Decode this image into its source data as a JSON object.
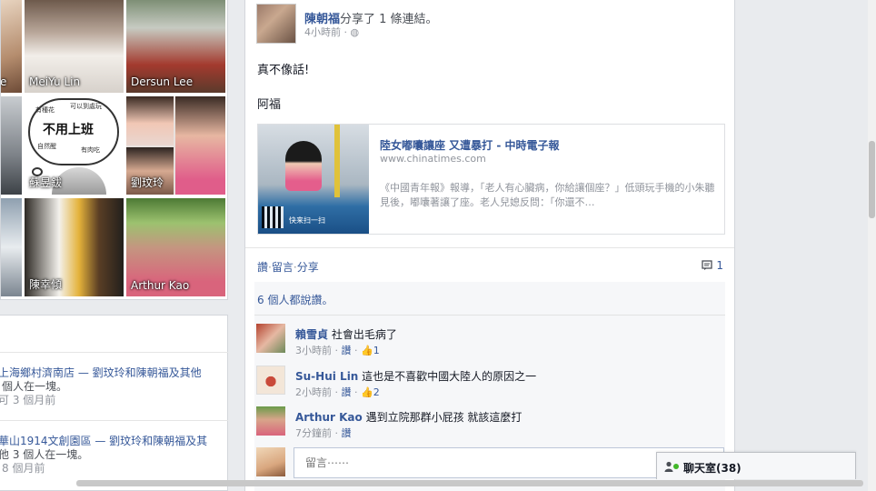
{
  "friends": [
    {
      "name": "e"
    },
    {
      "name": "MeiYu Lin"
    },
    {
      "name": "Dersun Lee"
    },
    {
      "name": "蘇昱鈸"
    },
    {
      "name": "劉玟玲"
    },
    {
      "name": "陳幸傾"
    },
    {
      "name": "Arthur Kao"
    }
  ],
  "bubble": {
    "main": "不用上班",
    "top_left": "有種花",
    "top_right": "可以到處玩",
    "bottom_left": "自然醒",
    "bottom_right": "有肉吃"
  },
  "places": [
    {
      "line1": "上海鄉村濟南店 — 劉玟玲和陳朝福及其他",
      "line2": "個人在一塊。",
      "line3": "可 3 個月前"
    },
    {
      "line1": "華山1914文創園區 — 劉玟玲和陳朝福及其",
      "line2": "他 3 個人在一塊。",
      "line3": "8 個月前"
    }
  ],
  "story": {
    "author": "陳朝福",
    "verb": "分享了 1 條連結。",
    "timestamp": "4小時前 · ◍",
    "message1": "真不像話!",
    "message2": "阿福",
    "link": {
      "title": "陸女嘟囔讓座 又遭暴打 - 中時電子報",
      "domain": "www.chinatimes.com",
      "description": "《中國青年報》報導，「老人有心臟病，你給讓個座？」低頭玩手機的小朱聽見後，嘟囔著讓了座。老人兒媳反問：「你還不…",
      "thumb_caption": "快来扫一扫"
    },
    "actions": {
      "like": "讚",
      "comment": "留言",
      "share": "分享",
      "sep": "·"
    },
    "comment_count": "1",
    "likes_line": "6 個人都說讚。",
    "comments": [
      {
        "name": "賴雪貞",
        "text": " 社會出毛病了",
        "time": "3小時前",
        "like": "讚",
        "likes": "1"
      },
      {
        "name": "Su-Hui Lin",
        "text": " 這也是不喜歡中國大陸人的原因之一",
        "time": "2小時前",
        "like": "讚",
        "likes": "2"
      },
      {
        "name": "Arthur Kao",
        "text": " 遇到立院那群小屁孩 就該這麼打",
        "time": "7分鐘前",
        "like": "讚",
        "likes": ""
      }
    ],
    "write_placeholder": "留言⋯⋯"
  },
  "chat": {
    "label": "聊天室(38)"
  },
  "colors": {
    "link": "#365899",
    "muted": "#90949c",
    "online": "#42b72a"
  }
}
